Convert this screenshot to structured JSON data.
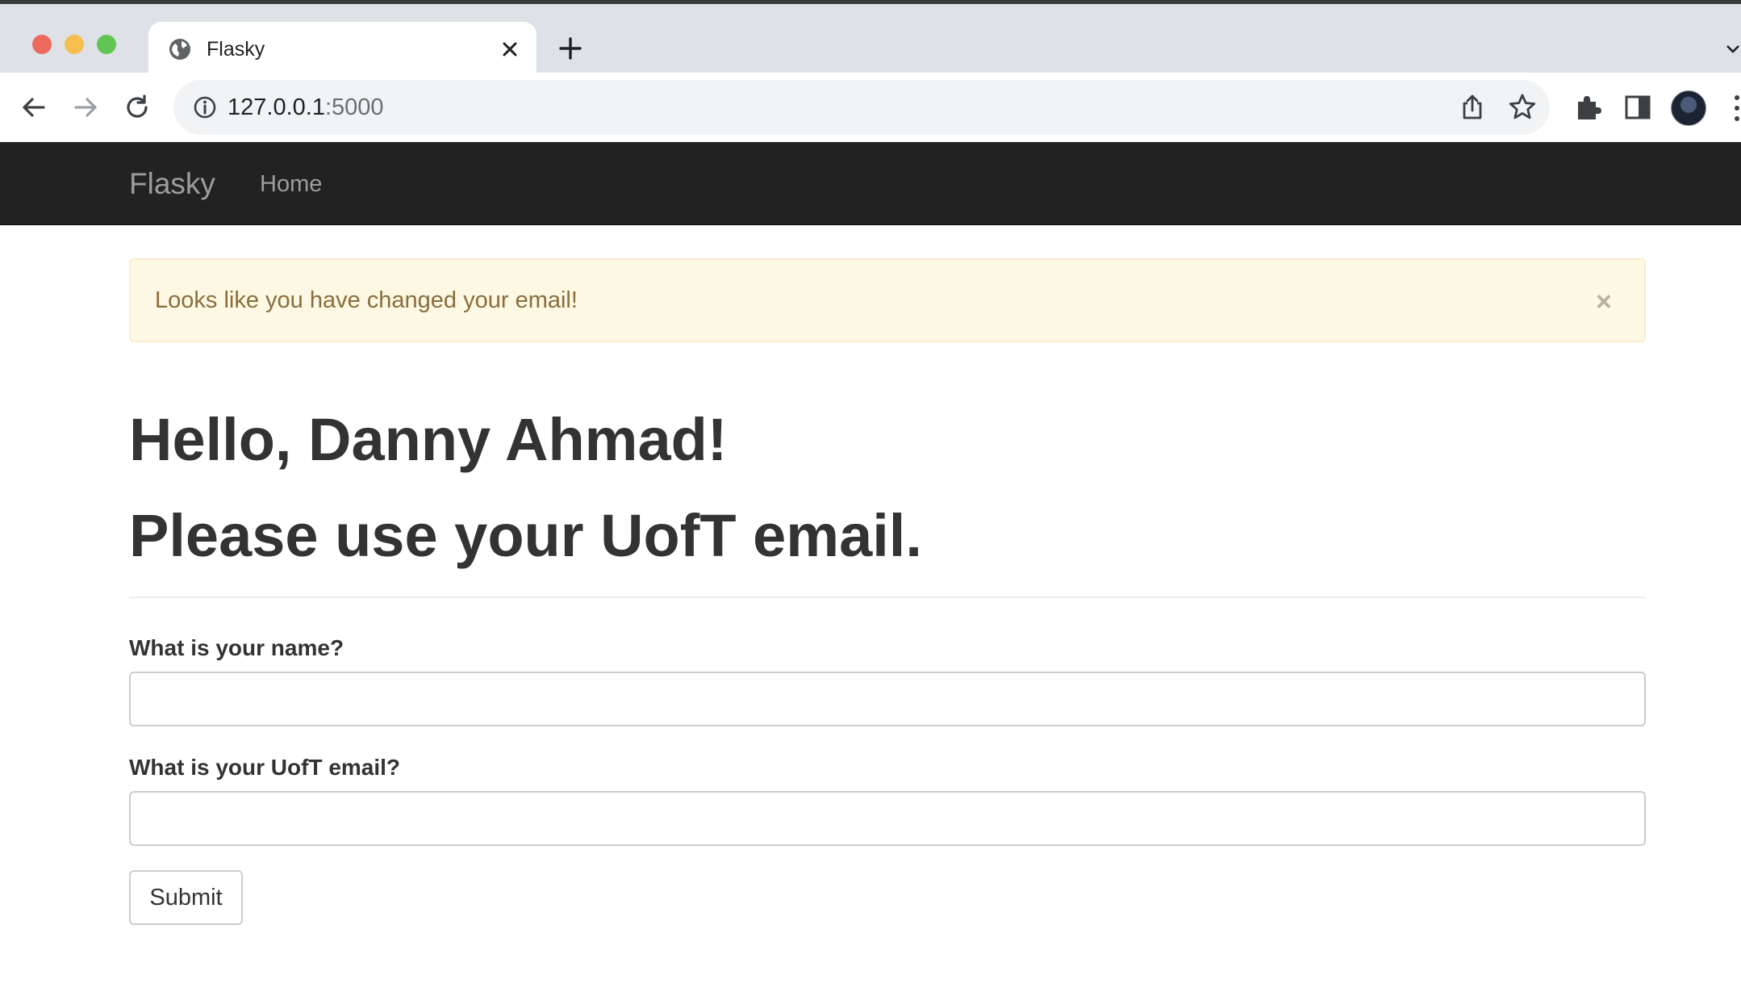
{
  "browser": {
    "tab": {
      "title": "Flasky",
      "favicon": "globe-icon"
    },
    "url": {
      "host": "127.0.0.1",
      "port": ":5000"
    },
    "icons": [
      "back-icon",
      "forward-icon",
      "reload-icon",
      "info-icon",
      "share-icon",
      "star-icon",
      "extensions-icon",
      "side-panel-icon",
      "avatar",
      "menu-icon"
    ]
  },
  "navbar": {
    "brand": "Flasky",
    "links": [
      {
        "label": "Home"
      }
    ]
  },
  "alert": {
    "message": "Looks like you have changed your email!",
    "close": "×",
    "color": "#fcf8e3"
  },
  "page": {
    "greeting": "Hello, Danny Ahmad!",
    "instruction": "Please use your UofT email."
  },
  "form": {
    "name_label": "What is your name?",
    "name_value": "",
    "email_label": "What is your UofT email?",
    "email_value": "",
    "submit_label": "Submit"
  }
}
